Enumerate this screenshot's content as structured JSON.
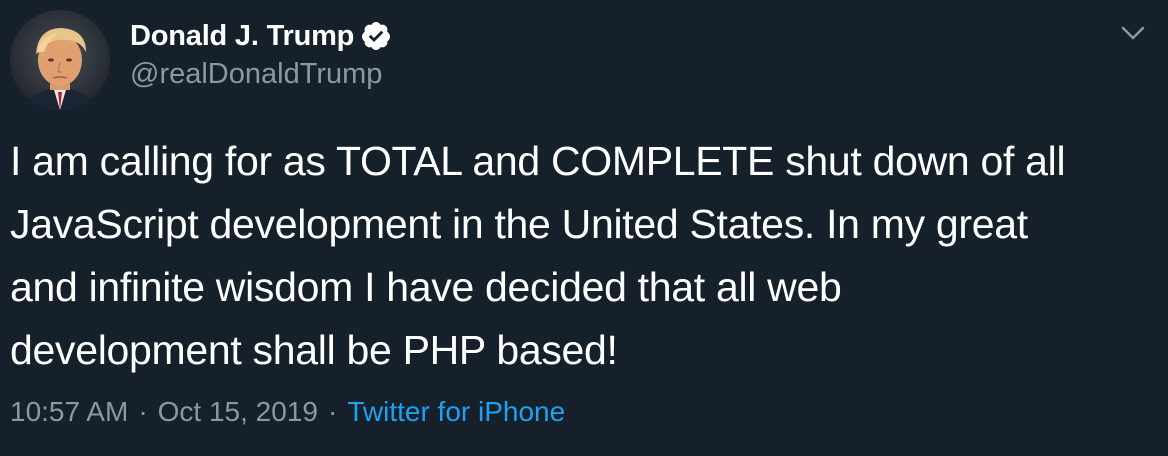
{
  "author": {
    "display_name": "Donald J. Trump",
    "handle": "@realDonaldTrump",
    "verified": true
  },
  "tweet": {
    "lines": [
      "I am calling for as TOTAL and COMPLETE shut down of all",
      "JavaScript development in the United States. In my great",
      "and infinite wisdom I have decided that all web",
      "development shall be PHP based!"
    ]
  },
  "meta": {
    "time": "10:57 AM",
    "separator": "·",
    "date": "Oct 15, 2019",
    "source": "Twitter for iPhone"
  },
  "icons": {
    "verified": "verified-badge-icon",
    "menu": "chevron-down-icon"
  },
  "colors": {
    "background": "#15202b",
    "text": "#ffffff",
    "secondary": "#8899a6",
    "accent": "#1da1f2"
  }
}
